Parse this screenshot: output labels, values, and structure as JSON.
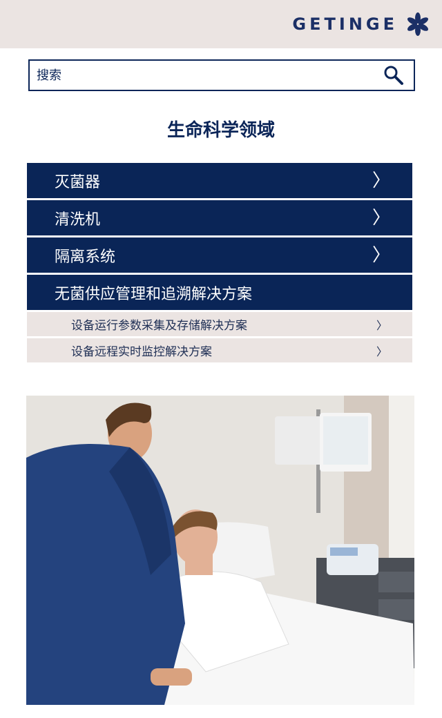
{
  "header": {
    "brand": "GETINGE"
  },
  "search": {
    "placeholder": "搜索"
  },
  "page": {
    "title": "生命科学领域"
  },
  "menu": {
    "items": [
      {
        "label": "灭菌器",
        "chevron": "〉"
      },
      {
        "label": "清洗机",
        "chevron": "〉"
      },
      {
        "label": "隔离系统",
        "chevron": "〉"
      },
      {
        "label": "无菌供应管理和追溯解决方案"
      }
    ],
    "subitems": [
      {
        "label": "设备运行参数采集及存储解决方案",
        "chevron": "〉"
      },
      {
        "label": "设备远程实时监控解决方案",
        "chevron": "〉"
      }
    ]
  },
  "colors": {
    "navy": "#0a2557",
    "header_bg": "#ebe4e2",
    "subitem_bg": "#ebe4e2"
  }
}
